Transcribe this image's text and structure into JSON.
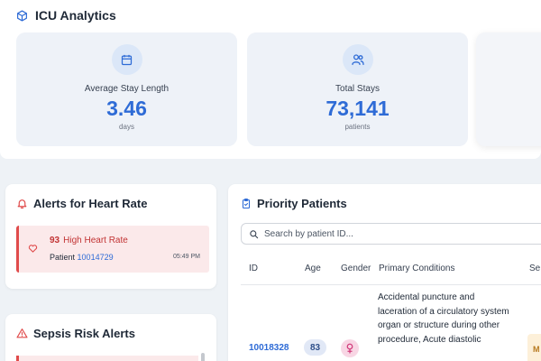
{
  "analytics": {
    "title": "ICU Analytics",
    "icon": "cube-icon",
    "stats": [
      {
        "label": "Average Stay Length",
        "value": "3.46",
        "unit": "days",
        "icon": "calendar-icon"
      },
      {
        "label": "Total Stays",
        "value": "73,141",
        "unit": "patients",
        "icon": "users-icon"
      }
    ]
  },
  "heart_alerts": {
    "title": "Alerts for Heart Rate",
    "icon": "bell-icon",
    "items": [
      {
        "value": "93",
        "message": "High Heart Rate",
        "patient_label": "Patient",
        "patient_id": "10014729",
        "time": "05:49 PM"
      }
    ]
  },
  "sepsis_alerts": {
    "title": "Sepsis Risk Alerts",
    "icon": "warning-triangle-icon"
  },
  "priority": {
    "title": "Priority Patients",
    "icon": "clipboard-icon",
    "search": {
      "placeholder": "Search by patient ID..."
    },
    "columns": [
      "ID",
      "Age",
      "Gender",
      "Primary Conditions",
      "Se"
    ],
    "rows": [
      {
        "id": "10018328",
        "age": "83",
        "gender": "female",
        "conditions": "Accidental puncture and laceration of a circulatory system organ or structure during other procedure, Acute diastolic",
        "severity": "M"
      }
    ]
  },
  "colors": {
    "accent": "#2e6bd6",
    "alert_red": "#e04b4b",
    "alert_bg": "#fbe9ea",
    "female_badge": "#f8d6e4"
  }
}
